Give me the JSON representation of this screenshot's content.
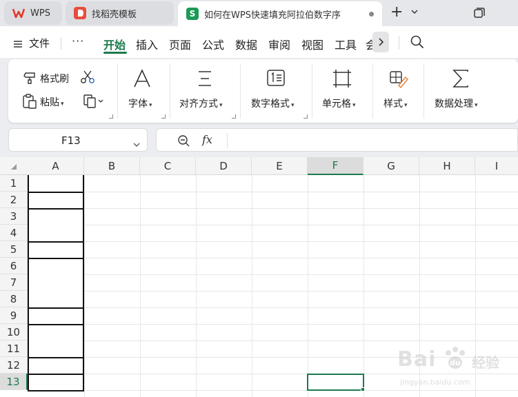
{
  "tabs": [
    {
      "label": "WPS",
      "logo": "W",
      "color": "#e23b2e"
    },
    {
      "label": "找稻壳模板",
      "logo": "D",
      "color": "#e84c3d"
    },
    {
      "label": "如何在WPS快速填充阿拉伯数字序",
      "logo": "S",
      "color": "#1b9a57"
    }
  ],
  "tab_actions": {
    "plus": "+",
    "menu": "⌄"
  },
  "menu": {
    "file": "文件",
    "more": "···",
    "items": [
      "开始",
      "插入",
      "页面",
      "公式",
      "数据",
      "审阅",
      "视图",
      "工具",
      "会"
    ]
  },
  "ribbon": {
    "format_painter": "格式刷",
    "paste": "粘贴",
    "font": "字体",
    "align": "对齐方式",
    "number_format": "数字格式",
    "cell": "单元格",
    "style": "样式",
    "data_process": "数据处理",
    "number_icon_text": "1≡"
  },
  "formula_bar": {
    "name_box": "F13",
    "fx": "fx",
    "content": ""
  },
  "grid": {
    "columns": [
      "A",
      "B",
      "C",
      "D",
      "E",
      "F",
      "G",
      "H",
      "I"
    ],
    "rows": [
      "1",
      "2",
      "3",
      "4",
      "5",
      "6",
      "7",
      "8",
      "9",
      "10",
      "11",
      "12",
      "13"
    ],
    "selected_column": "F",
    "selected_row": "13",
    "active_cell": "F13"
  },
  "watermark": {
    "main": "Bai",
    "cn": "经验",
    "url": "jingyan.baidu.com"
  },
  "colors": {
    "accent": "#1b7a4b",
    "border": "#111111"
  }
}
